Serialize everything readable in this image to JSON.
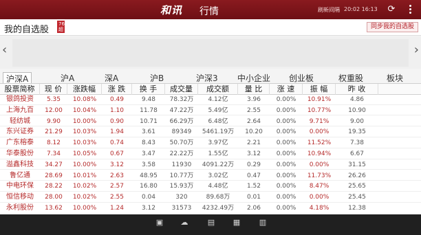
{
  "header": {
    "logo": "和讯",
    "title": "行情",
    "refresh_label": "刷新间隔",
    "refresh_time": "20:02 16:13",
    "refresh_icon": "refresh-icon",
    "menu_icon": "more-vertical-icon"
  },
  "subheader": {
    "title": "我的自选股",
    "badge": "76 超",
    "sync_label": "同步我的自选股"
  },
  "tabs": [
    "沪深A",
    "沪A",
    "深A",
    "沪B",
    "沪深3",
    "中小企业",
    "创业板",
    "权重股",
    "板块"
  ],
  "active_tab": 0,
  "table": {
    "columns": [
      "股票简称",
      "现 价",
      "涨跌幅",
      "涨 跌",
      "换 手",
      "成交量",
      "成交额",
      "量 比",
      "涨 速",
      "振 幅",
      "昨 收"
    ],
    "rows": [
      [
        "银鸽投资",
        "5.35",
        "10.08%",
        "0.49",
        "9.48",
        "78.32万",
        "4.12亿",
        "3.96",
        "0.00%",
        "10.91%",
        "4.86"
      ],
      [
        "上海九百",
        "12.00",
        "10.04%",
        "1.10",
        "11.78",
        "47.22万",
        "5.49亿",
        "2.55",
        "0.00%",
        "10.77%",
        "10.90"
      ],
      [
        "轻纺城",
        "9.90",
        "10.00%",
        "0.90",
        "10.71",
        "66.29万",
        "6.48亿",
        "2.64",
        "0.00%",
        "9.71%",
        "9.00"
      ],
      [
        "东兴证券",
        "21.29",
        "10.03%",
        "1.94",
        "3.61",
        "89349",
        "5461.19万",
        "10.20",
        "0.00%",
        "0.00%",
        "19.35"
      ],
      [
        "广东榕泰",
        "8.12",
        "10.03%",
        "0.74",
        "8.43",
        "50.70万",
        "3.97亿",
        "2.21",
        "0.00%",
        "11.52%",
        "7.38"
      ],
      [
        "华泰股份",
        "7.34",
        "10.05%",
        "0.67",
        "3.47",
        "22.22万",
        "1.55亿",
        "3.12",
        "0.00%",
        "10.94%",
        "6.67"
      ],
      [
        "溢鑫科技",
        "34.27",
        "10.00%",
        "3.12",
        "3.58",
        "11930",
        "4091.22万",
        "0.29",
        "0.00%",
        "0.00%",
        "31.15"
      ],
      [
        "鲁亿通",
        "28.69",
        "10.01%",
        "2.63",
        "48.95",
        "10.77万",
        "3.02亿",
        "0.47",
        "0.00%",
        "11.73%",
        "26.26"
      ],
      [
        "中电环保",
        "28.22",
        "10.02%",
        "2.57",
        "16.80",
        "15.93万",
        "4.48亿",
        "1.52",
        "0.00%",
        "8.47%",
        "25.65"
      ],
      [
        "恒信移动",
        "28.00",
        "10.02%",
        "2.55",
        "0.04",
        "320",
        "89.68万",
        "0.01",
        "0.00%",
        "0.00%",
        "25.45"
      ],
      [
        "永利股份",
        "13.62",
        "10.00%",
        "1.24",
        "3.12",
        "31573",
        "4232.49万",
        "2.06",
        "0.00%",
        "4.18%",
        "12.38"
      ]
    ]
  },
  "bottom_icons": [
    "home-icon",
    "market-icon",
    "news-icon",
    "trade-icon",
    "user-icon"
  ]
}
